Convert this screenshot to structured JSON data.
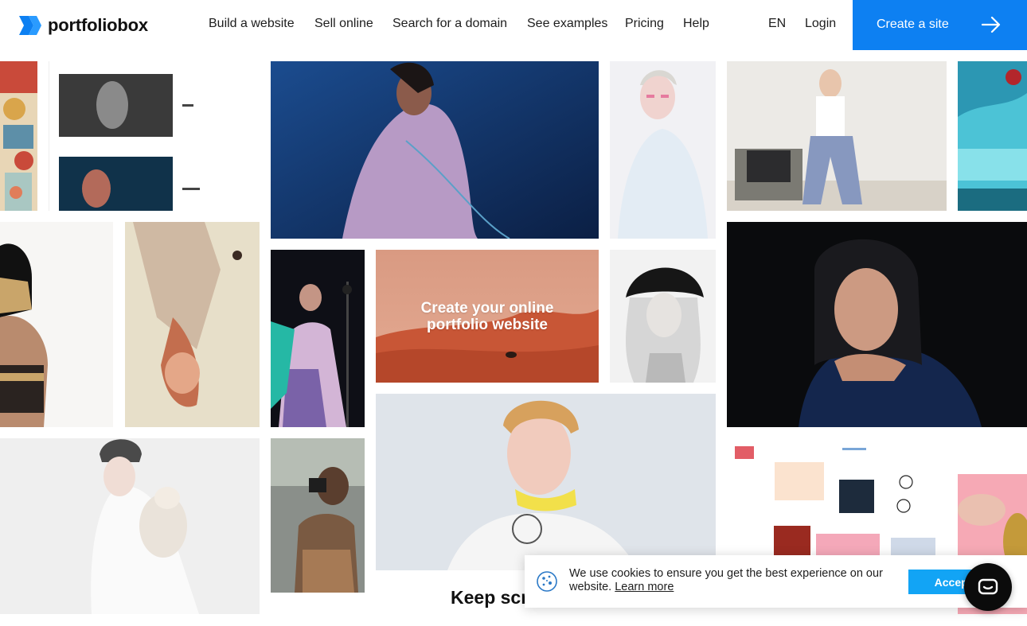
{
  "brand": {
    "name": "portfoliobox",
    "color": "#0d80f2"
  },
  "nav": {
    "items": [
      {
        "label": "Build a website"
      },
      {
        "label": "Sell online"
      },
      {
        "label": "Search for a domain"
      },
      {
        "label": "See examples"
      },
      {
        "label": "Pricing"
      },
      {
        "label": "Help"
      }
    ],
    "language": "EN",
    "login": "Login",
    "cta": "Create a site"
  },
  "hero": {
    "line1": "Create your online",
    "line2": "portfolio website"
  },
  "keep_scrolling": "Keep scr",
  "cookie": {
    "message": "We use cookies to ensure you get the best experience on our website.",
    "learn_more": "Learn more",
    "accept": "Accept"
  },
  "colors": {
    "accent": "#0d80f2",
    "accept_button": "#12a4f5",
    "chat_button": "#0b0b0b"
  }
}
